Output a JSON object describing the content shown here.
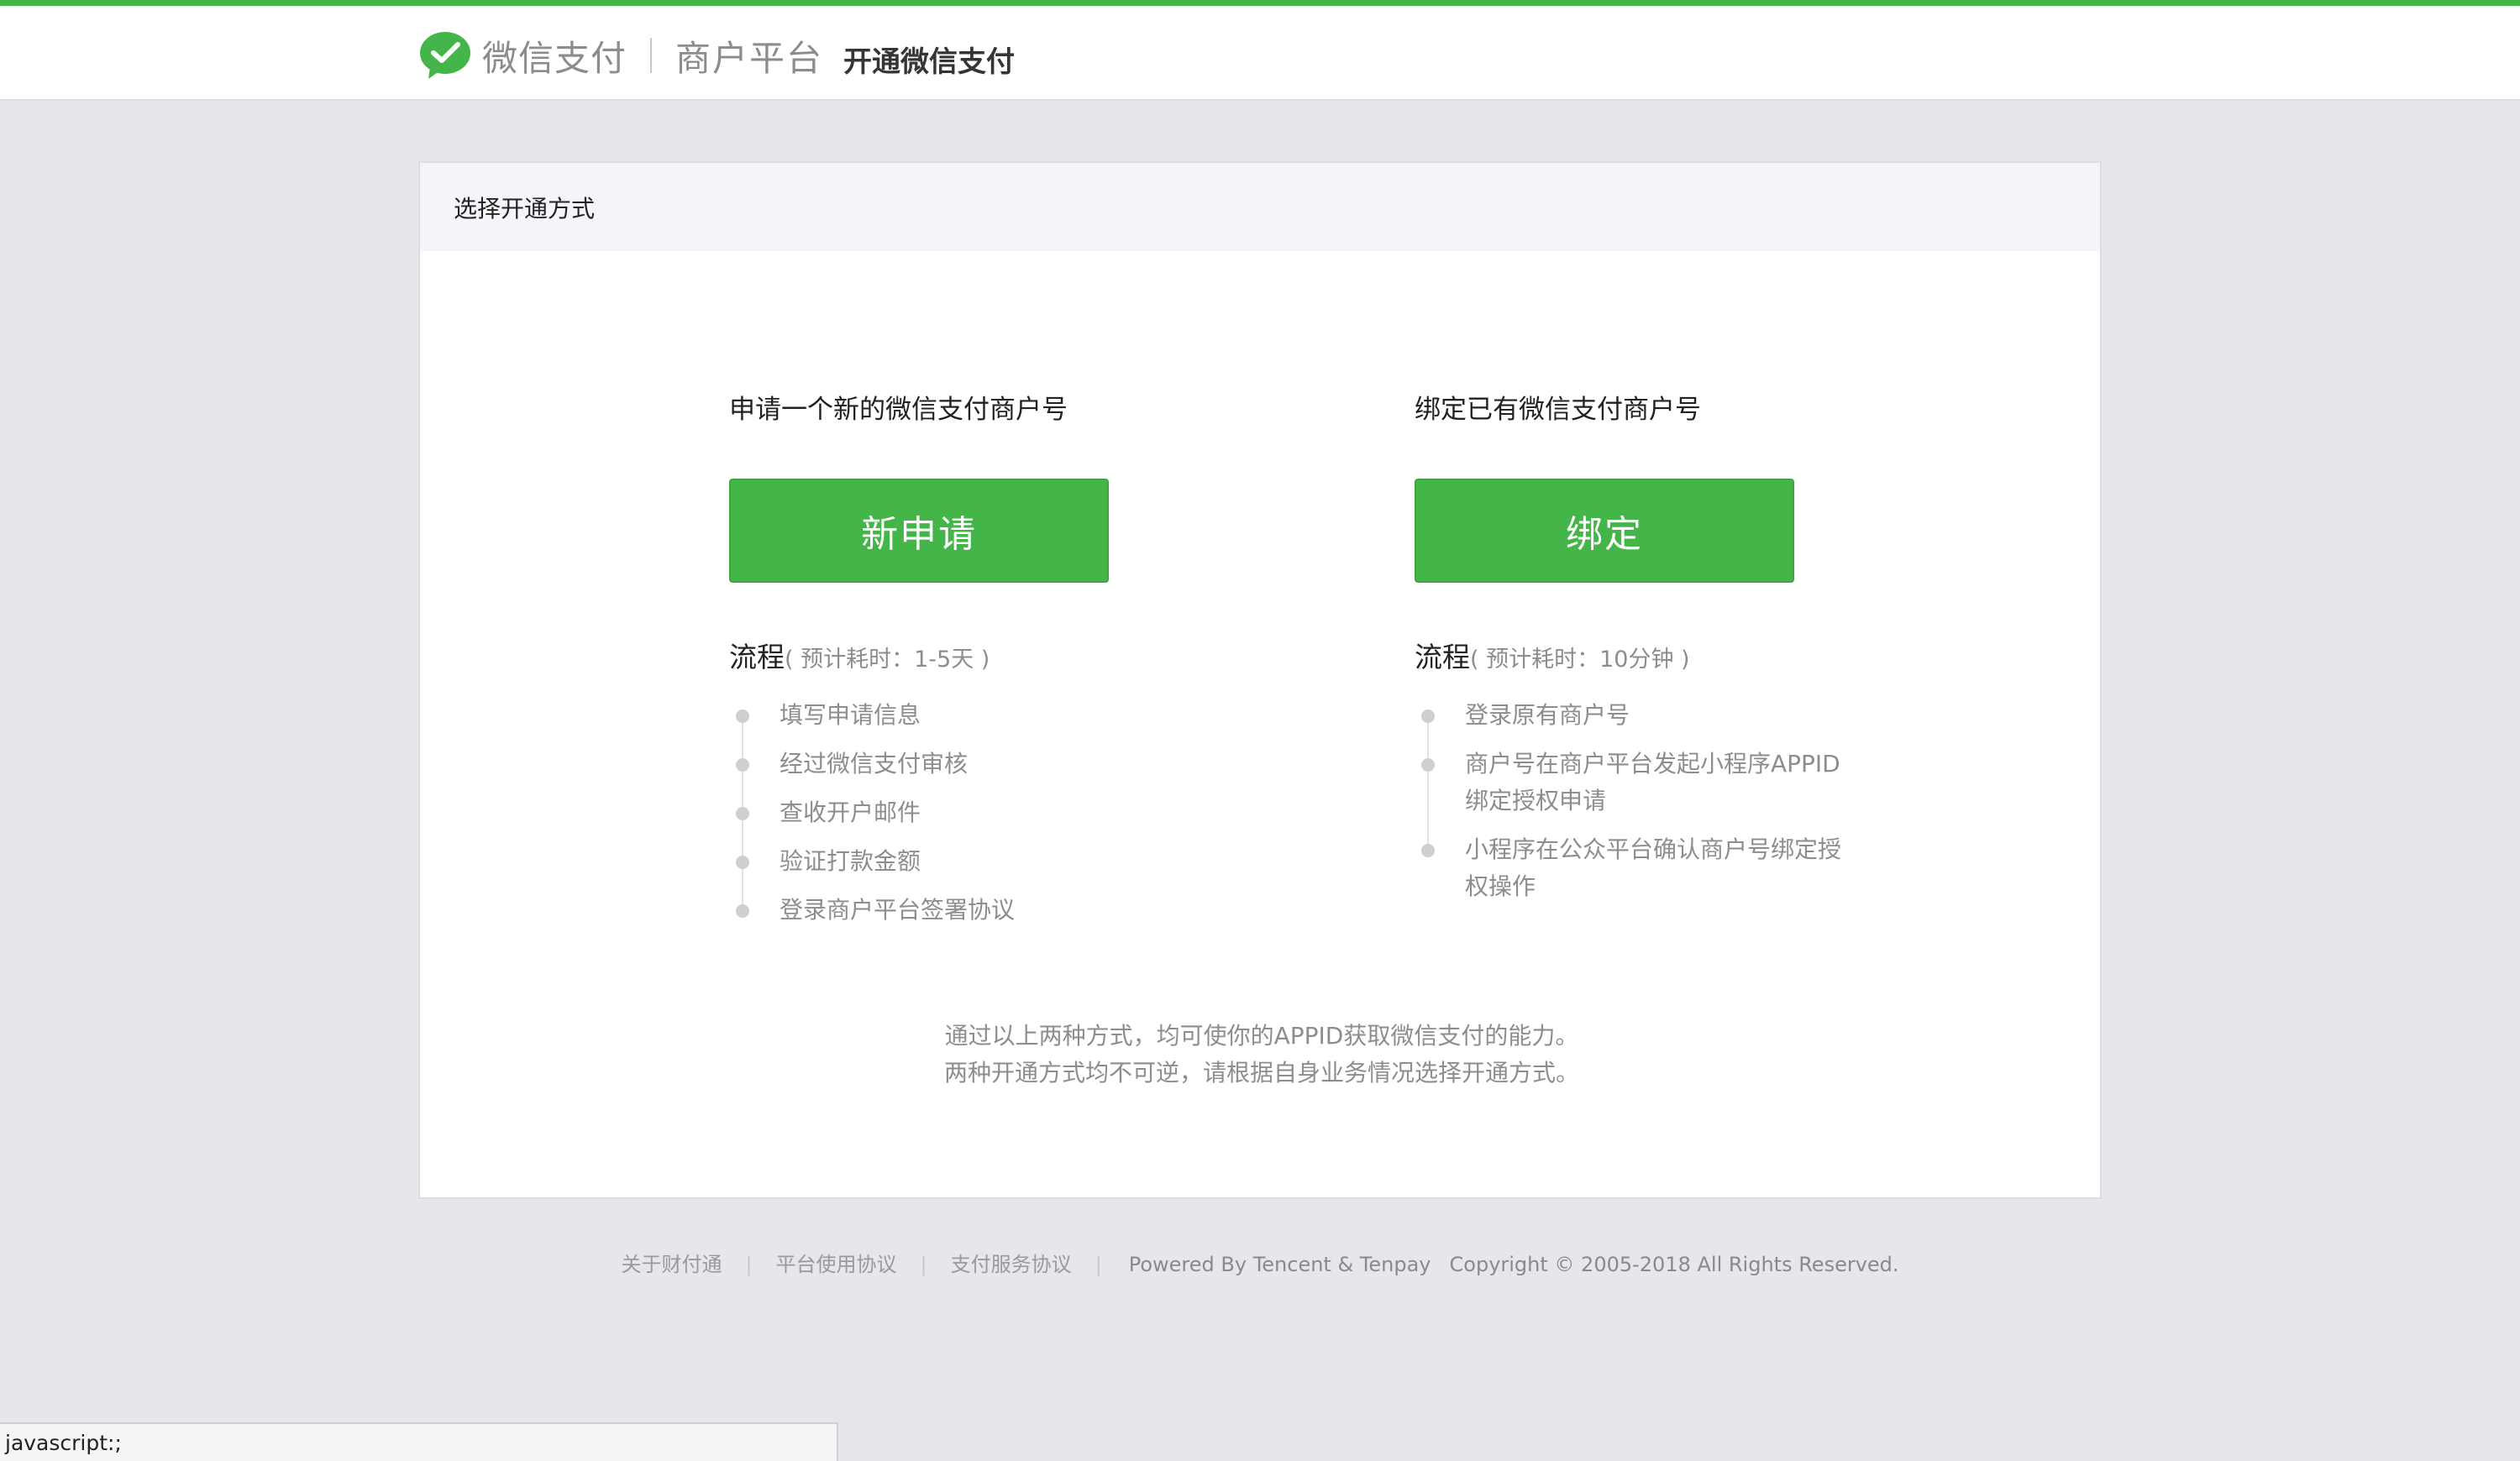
{
  "header": {
    "brand_name": "微信支付",
    "platform": "商户平台",
    "subtitle": "开通微信支付",
    "logo_icon": "wechat-logo-icon",
    "accent_color": "#44b549"
  },
  "card": {
    "title": "选择开通方式",
    "left": {
      "heading": "申请一个新的微信支付商户号",
      "button_label": "新申请",
      "flow_label": "流程",
      "flow_time": "( 预计耗时：1-5天 )",
      "steps": [
        "填写申请信息",
        "经过微信支付审核",
        "查收开户邮件",
        "验证打款金额",
        "登录商户平台签署协议"
      ]
    },
    "right": {
      "heading": "绑定已有微信支付商户号",
      "button_label": "绑定",
      "flow_label": "流程",
      "flow_time": "( 预计耗时：10分钟 )",
      "steps": [
        [
          "登录原有商户号"
        ],
        [
          "商户号在商户平台发起小程序APPID",
          "绑定授权申请"
        ],
        [
          "小程序在公众平台确认商户号绑定授",
          "权操作"
        ]
      ]
    },
    "note_line1": "通过以上两种方式，均可使你的APPID获取微信支付的能力。",
    "note_line2": "两种开通方式均不可逆，请根据自身业务情况选择开通方式。"
  },
  "footer": {
    "links": [
      "关于财付通",
      "平台使用协议",
      "支付服务协议"
    ],
    "separator": "|",
    "powered": "Powered By Tencent & Tenpay",
    "copyright": "Copyright © 2005-2018 All Rights Reserved."
  },
  "statusbar": {
    "text": "javascript:;"
  }
}
